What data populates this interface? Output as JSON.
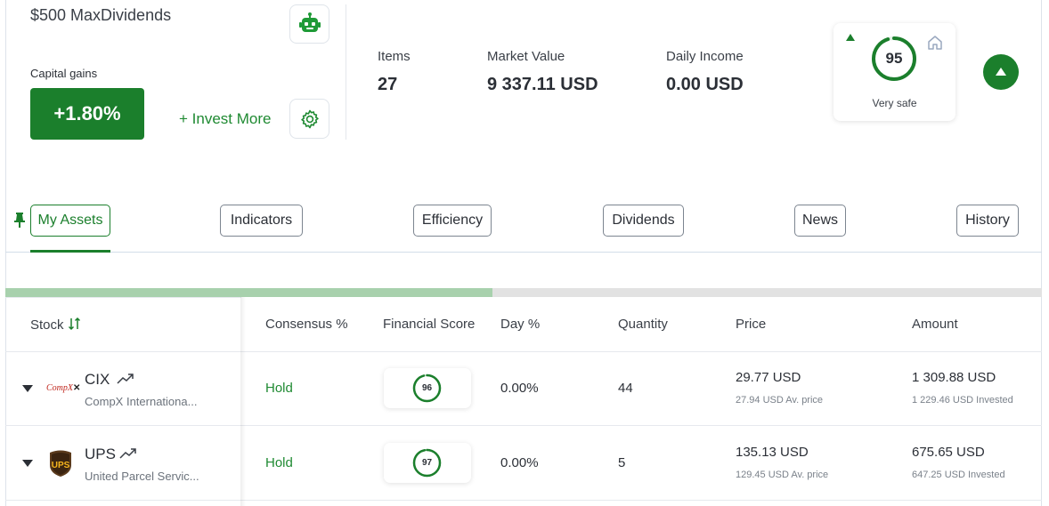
{
  "header": {
    "portfolio_name": "$500 MaxDividends",
    "capital_gains_label": "Capital gains",
    "capital_gains_value": "+1.80%",
    "invest_more": "+ Invest More",
    "icons": {
      "bot": "robot-icon",
      "settings": "gear-icon"
    }
  },
  "stats": [
    {
      "label": "Items",
      "value": "27"
    },
    {
      "label": "Market Value",
      "value": "9 337.11 USD"
    },
    {
      "label": "Daily Income",
      "value": "0.00 USD"
    }
  ],
  "safety": {
    "score": "95",
    "score_fraction": 0.95,
    "label": "Very safe",
    "trend": "up",
    "color": "#1b7f2c"
  },
  "tabs": [
    {
      "label": "My Assets",
      "active": true
    },
    {
      "label": "Indicators",
      "active": false
    },
    {
      "label": "Efficiency",
      "active": false
    },
    {
      "label": "Dividends",
      "active": false
    },
    {
      "label": "News",
      "active": false
    },
    {
      "label": "History",
      "active": false
    }
  ],
  "scroll_progress": 0.47,
  "table": {
    "columns": {
      "stock": "Stock",
      "consensus": "Consensus %",
      "financial_score": "Financial Score",
      "day": "Day %",
      "quantity": "Quantity",
      "price": "Price",
      "amount": "Amount"
    },
    "rows": [
      {
        "logo": "CompX",
        "ticker": "CIX",
        "company": "CompX Internationa...",
        "consensus": "Hold",
        "score": "96",
        "score_fraction": 0.96,
        "day": "0.00%",
        "quantity": "44",
        "price": "29.77 USD",
        "avg_price": "27.94 USD Av. price",
        "amount": "1 309.88 USD",
        "invested": "1 229.46 USD Invested"
      },
      {
        "logo": "UPS",
        "ticker": "UPS",
        "company": "United Parcel Servic...",
        "consensus": "Hold",
        "score": "97",
        "score_fraction": 0.97,
        "day": "0.00%",
        "quantity": "5",
        "price": "135.13 USD",
        "avg_price": "129.45 USD Av. price",
        "amount": "675.65 USD",
        "invested": "647.25 USD Invested"
      }
    ]
  },
  "colors": {
    "accent": "#1b7f2c",
    "accent_light": "#a8d1ad"
  }
}
